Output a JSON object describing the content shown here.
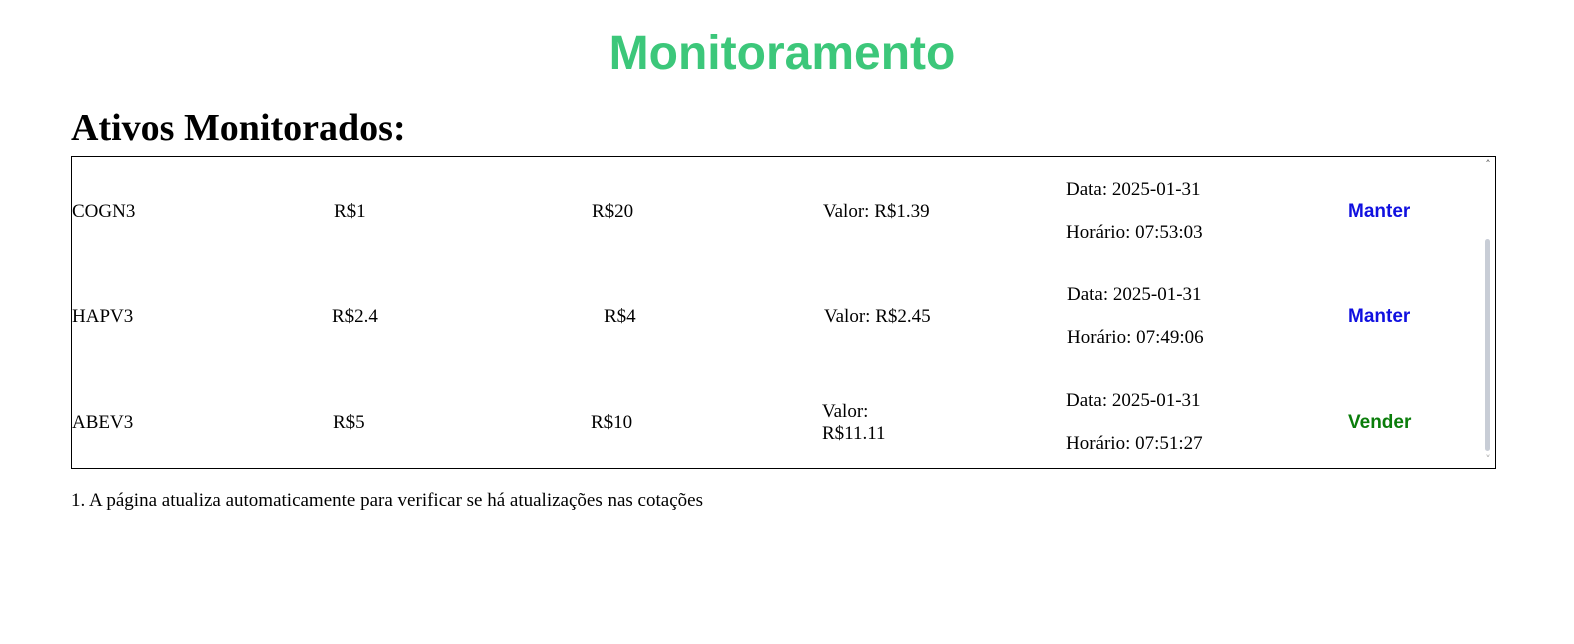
{
  "page": {
    "title": "Monitoramento",
    "section_heading": "Ativos Monitorados:",
    "footnote": "1. A página atualiza automaticamente para verificar se há atualizações nas cotações"
  },
  "assets": [
    {
      "ticker": "COGN3",
      "min": "R$1",
      "max": "R$20",
      "valor_label": "Valor:",
      "valor": "R$1.39",
      "data": "Data: 2025-01-31",
      "horario": "Horário: 07:53:03",
      "status": "Manter"
    },
    {
      "ticker": "HAPV3",
      "min": "R$2.4",
      "max": "R$4",
      "valor_label": "Valor:",
      "valor": "R$2.45",
      "data": "Data: 2025-01-31",
      "horario": "Horário: 07:49:06",
      "status": "Manter"
    },
    {
      "ticker": "ABEV3",
      "min": "R$5",
      "max": "R$10",
      "valor_label": "Valor:",
      "valor": "R$11.11",
      "data": "Data: 2025-01-31",
      "horario": "Horário: 07:51:27",
      "status": "Vender"
    }
  ],
  "colors": {
    "title": "#3cc77a",
    "manter": "#1010e0",
    "vender": "#0a7d0a"
  },
  "icons": {
    "scroll_up": "chevron-up-icon",
    "scroll_down": "chevron-down-icon"
  }
}
